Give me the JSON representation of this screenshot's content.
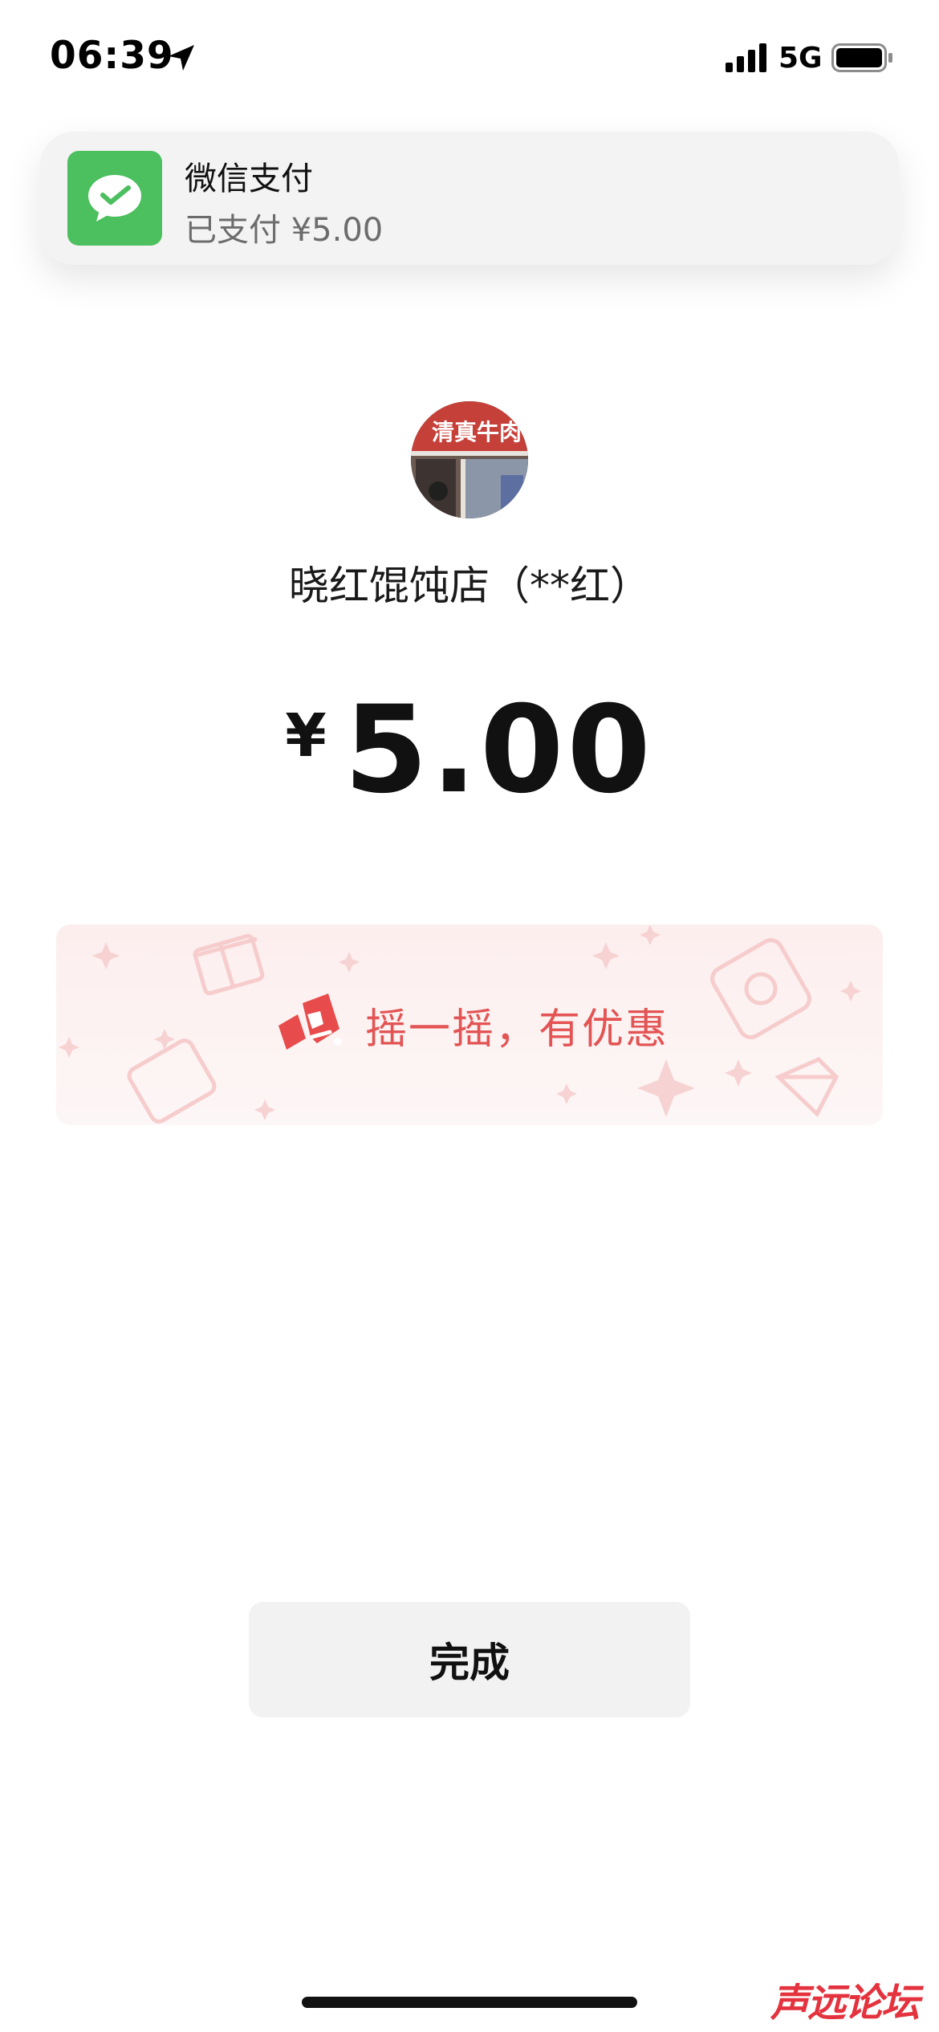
{
  "status_bar": {
    "time": "06:39",
    "network": "5G"
  },
  "notification": {
    "app_name": "微信支付",
    "message": "已支付 ¥5.00",
    "app_icon": "wechat-pay-icon",
    "icon_color": "#4cbf5e"
  },
  "merchant": {
    "avatar_sign_text": "清真牛肉",
    "name": "晓红馄饨店（**红）"
  },
  "payment": {
    "currency_symbol": "¥",
    "amount": "5.00"
  },
  "promo": {
    "text": "摇一摇，有优惠",
    "icon": "shake-icon",
    "accent_color": "#e35454"
  },
  "actions": {
    "done_label": "完成"
  },
  "watermark": {
    "text": "声远论坛"
  }
}
